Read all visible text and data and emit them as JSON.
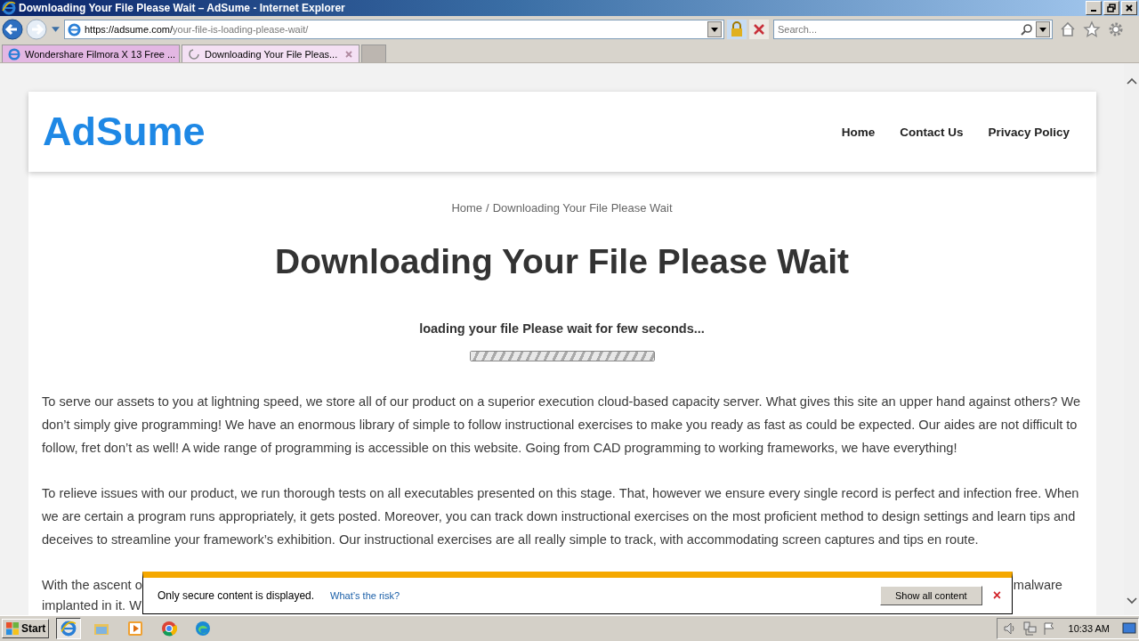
{
  "window": {
    "title": "Downloading Your File Please Wait – AdSume - Internet Explorer"
  },
  "address_bar": {
    "host": "https://adsume.com/",
    "path": "your-file-is-loading-please-wait/"
  },
  "search": {
    "placeholder": "Search..."
  },
  "tabs": [
    {
      "label": "Wondershare Filmora X 13 Free ...",
      "selected": false,
      "loading": false
    },
    {
      "label": "Downloading Your File Pleas...",
      "selected": true,
      "loading": true
    }
  ],
  "site": {
    "logo": "AdSume",
    "nav": [
      "Home",
      "Contact Us",
      "Privacy Policy"
    ]
  },
  "breadcrumb": {
    "home": "Home",
    "separator": "/",
    "current": "Downloading Your File Please Wait"
  },
  "heading": "Downloading Your File Please Wait",
  "loading_text": "loading your file Please wait for few seconds...",
  "progress": {
    "level": 1
  },
  "paragraphs": [
    "To serve our assets to you at lightning speed, we store all of our product on a superior execution cloud-based capacity server. What gives this site an upper hand against others? We don’t simply give programming! We have an enormous library of simple to follow instructional exercises to make you ready as fast as could be expected. Our aides are not difficult to follow, fret don’t as well! A wide range of programming is accessible on this website. Going from CAD programming to working frameworks, we have everything!",
    "To relieve issues with our product, we run thorough tests on all executables presented on this stage. That, however we ensure every single record is perfect and infection free. When we are certain a program runs appropriately, it gets posted. Moreover, you can track down instructional exercises on the most proficient method to design settings and learn tips and deceives to streamline your framework’s exhibition. Our instructional exercises are all really simple to track, with accommodating screen captures and tips en route."
  ],
  "hidden_paragraph": {
    "line_1_start": "With the ascent o",
    "line_1_end": "malware",
    "line_2_start": "implanted in it. W"
  },
  "notification": {
    "message": "Only secure content is displayed.",
    "link": "What’s the risk?",
    "button": "Show all content",
    "close": "×"
  },
  "taskbar": {
    "start": "Start",
    "clock": "10:33 AM"
  }
}
